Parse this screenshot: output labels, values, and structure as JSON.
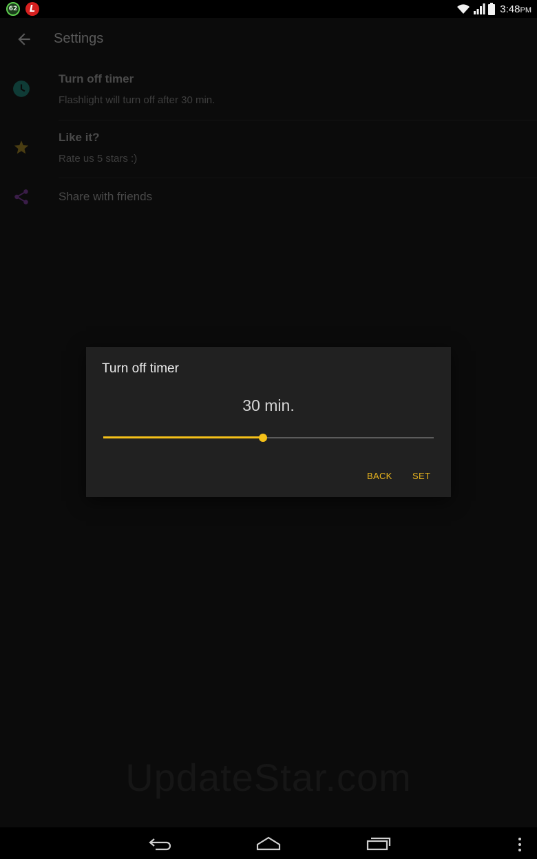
{
  "status_bar": {
    "notification_count": "62",
    "notification_app_letter": "L",
    "time": "3:48",
    "time_suffix": "PM",
    "icons": [
      "wifi-icon",
      "signal-icon",
      "battery-icon"
    ]
  },
  "toolbar": {
    "title": "Settings",
    "back_icon": "back-arrow-icon"
  },
  "settings": [
    {
      "title": "Turn off timer",
      "subtitle": "Flashlight will turn off after 30 min.",
      "icon": "clock-icon",
      "icon_color": "#0f3b36"
    },
    {
      "title": "Like it?",
      "subtitle": "Rate us 5 stars :)",
      "icon": "star-icon",
      "icon_color": "#4a3d12"
    },
    {
      "title": "Share with friends",
      "subtitle": "",
      "icon": "share-icon",
      "icon_color": "#3a1d48"
    }
  ],
  "dialog": {
    "title": "Turn off timer",
    "value_label": "30 min.",
    "slider_fraction": 0.483,
    "back_label": "BACK",
    "set_label": "SET",
    "accent_color": "#f5c119"
  },
  "watermark": "UpdateStar.com",
  "nav_bar": {
    "icons": [
      "back-nav-icon",
      "home-nav-icon",
      "recents-nav-icon",
      "overflow-menu-icon"
    ]
  }
}
